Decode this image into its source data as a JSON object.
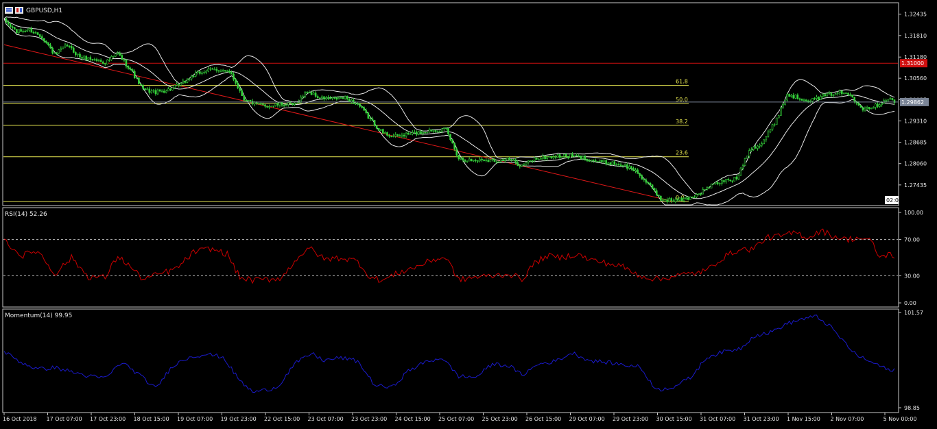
{
  "chart_data": [
    {
      "type": "candlestick",
      "title": "GBPUSD,H1",
      "symbol": "GBPUSD",
      "timeframe": "H1",
      "ylim": [
        1.2685,
        1.3275
      ],
      "y_ticks": [
        "1.32435",
        "1.31810",
        "1.31180",
        "1.30560",
        "1.29935",
        "1.29310",
        "1.28685",
        "1.28060",
        "1.27435"
      ],
      "x_ticks": [
        "16 Oct 2018",
        "17 Oct 07:00",
        "17 Oct 23:00",
        "18 Oct 15:00",
        "19 Oct 07:00",
        "19 Oct 23:00",
        "22 Oct 15:00",
        "23 Oct 07:00",
        "23 Oct 23:00",
        "24 Oct 15:00",
        "25 Oct 07:00",
        "25 Oct 23:00",
        "26 Oct 15:00",
        "29 Oct 07:00",
        "29 Oct 23:00",
        "30 Oct 15:00",
        "31 Oct 07:00",
        "31 Oct 23:00",
        "1 Nov 15:00",
        "2 Nov 07:00",
        "5 Nov 00:00"
      ],
      "current_price": "1.29862",
      "current_price_value": 1.29862,
      "resistance_level": "1.31000",
      "resistance_value": 1.31,
      "fibonacci_levels": [
        {
          "label": "61.8",
          "price": 1.3035
        },
        {
          "label": "50.0",
          "price": 1.2982
        },
        {
          "label": "38.2",
          "price": 1.2918
        },
        {
          "label": "23.6",
          "price": 1.2826
        },
        {
          "label": "0.0",
          "price": 1.2695
        }
      ],
      "trendline": {
        "from": {
          "x": "16 Oct 2018",
          "price": 1.3154
        },
        "to": {
          "x": "30 Oct 15:00",
          "price": 1.2695
        }
      },
      "countdown": "02:0",
      "close_path": [
        {
          "i": 0,
          "price": 1.3225
        },
        {
          "i": 6,
          "price": 1.3192
        },
        {
          "i": 12,
          "price": 1.3198
        },
        {
          "i": 18,
          "price": 1.3178
        },
        {
          "i": 24,
          "price": 1.3125
        },
        {
          "i": 30,
          "price": 1.3152
        },
        {
          "i": 36,
          "price": 1.3118
        },
        {
          "i": 42,
          "price": 1.3112
        },
        {
          "i": 48,
          "price": 1.3102
        },
        {
          "i": 54,
          "price": 1.3128
        },
        {
          "i": 60,
          "price": 1.3082
        },
        {
          "i": 66,
          "price": 1.3022
        },
        {
          "i": 72,
          "price": 1.3015
        },
        {
          "i": 78,
          "price": 1.3022
        },
        {
          "i": 84,
          "price": 1.3038
        },
        {
          "i": 90,
          "price": 1.3065
        },
        {
          "i": 96,
          "price": 1.3078
        },
        {
          "i": 102,
          "price": 1.3082
        },
        {
          "i": 108,
          "price": 1.3068
        },
        {
          "i": 114,
          "price": 1.2995
        },
        {
          "i": 120,
          "price": 1.2978
        },
        {
          "i": 126,
          "price": 1.2975
        },
        {
          "i": 132,
          "price": 1.298
        },
        {
          "i": 138,
          "price": 1.2978
        },
        {
          "i": 144,
          "price": 1.3018
        },
        {
          "i": 150,
          "price": 1.2998
        },
        {
          "i": 156,
          "price": 1.2995
        },
        {
          "i": 162,
          "price": 1.2998
        },
        {
          "i": 168,
          "price": 1.298
        },
        {
          "i": 174,
          "price": 1.2935
        },
        {
          "i": 180,
          "price": 1.2895
        },
        {
          "i": 186,
          "price": 1.2885
        },
        {
          "i": 192,
          "price": 1.2892
        },
        {
          "i": 198,
          "price": 1.2898
        },
        {
          "i": 204,
          "price": 1.2905
        },
        {
          "i": 210,
          "price": 1.2905
        },
        {
          "i": 216,
          "price": 1.2822
        },
        {
          "i": 222,
          "price": 1.2815
        },
        {
          "i": 228,
          "price": 1.2818
        },
        {
          "i": 234,
          "price": 1.2815
        },
        {
          "i": 240,
          "price": 1.2818
        },
        {
          "i": 246,
          "price": 1.28
        },
        {
          "i": 252,
          "price": 1.282
        },
        {
          "i": 258,
          "price": 1.2825
        },
        {
          "i": 264,
          "price": 1.2828
        },
        {
          "i": 270,
          "price": 1.2828
        },
        {
          "i": 276,
          "price": 1.2822
        },
        {
          "i": 282,
          "price": 1.2812
        },
        {
          "i": 288,
          "price": 1.2808
        },
        {
          "i": 294,
          "price": 1.2802
        },
        {
          "i": 300,
          "price": 1.2785
        },
        {
          "i": 306,
          "price": 1.2745
        },
        {
          "i": 312,
          "price": 1.2702
        },
        {
          "i": 318,
          "price": 1.2698
        },
        {
          "i": 324,
          "price": 1.2702
        },
        {
          "i": 330,
          "price": 1.2718
        },
        {
          "i": 336,
          "price": 1.2742
        },
        {
          "i": 342,
          "price": 1.2755
        },
        {
          "i": 348,
          "price": 1.2762
        },
        {
          "i": 354,
          "price": 1.2848
        },
        {
          "i": 360,
          "price": 1.2865
        },
        {
          "i": 366,
          "price": 1.2925
        },
        {
          "i": 372,
          "price": 1.3008
        },
        {
          "i": 378,
          "price": 1.2998
        },
        {
          "i": 384,
          "price": 1.2992
        },
        {
          "i": 390,
          "price": 1.3005
        },
        {
          "i": 396,
          "price": 1.3015
        },
        {
          "i": 402,
          "price": 1.3008
        },
        {
          "i": 408,
          "price": 1.2968
        },
        {
          "i": 414,
          "price": 1.2975
        },
        {
          "i": 420,
          "price": 1.2998
        },
        {
          "i": 423,
          "price": 1.2986
        }
      ],
      "series": [
        {
          "name": "Bollinger Bands",
          "color": "#e8e8e8"
        }
      ]
    },
    {
      "type": "line",
      "indicator": "RSI",
      "title": "RSI(14) 52.26",
      "ylim": [
        0,
        100
      ],
      "y_ticks": [
        "100.00",
        "70.00",
        "30.00",
        "0.00"
      ],
      "levels": [
        70,
        30
      ],
      "series": [
        {
          "color": "#cc0000",
          "points": [
            {
              "i": 0,
              "v": 70
            },
            {
              "i": 8,
              "v": 52
            },
            {
              "i": 16,
              "v": 58
            },
            {
              "i": 24,
              "v": 32
            },
            {
              "i": 32,
              "v": 50
            },
            {
              "i": 40,
              "v": 29
            },
            {
              "i": 48,
              "v": 28
            },
            {
              "i": 54,
              "v": 52
            },
            {
              "i": 60,
              "v": 40
            },
            {
              "i": 66,
              "v": 26
            },
            {
              "i": 74,
              "v": 32
            },
            {
              "i": 82,
              "v": 38
            },
            {
              "i": 90,
              "v": 56
            },
            {
              "i": 98,
              "v": 60
            },
            {
              "i": 106,
              "v": 54
            },
            {
              "i": 112,
              "v": 28
            },
            {
              "i": 118,
              "v": 25
            },
            {
              "i": 126,
              "v": 26
            },
            {
              "i": 132,
              "v": 28
            },
            {
              "i": 140,
              "v": 52
            },
            {
              "i": 146,
              "v": 60
            },
            {
              "i": 152,
              "v": 48
            },
            {
              "i": 160,
              "v": 50
            },
            {
              "i": 168,
              "v": 46
            },
            {
              "i": 174,
              "v": 28
            },
            {
              "i": 180,
              "v": 25
            },
            {
              "i": 188,
              "v": 34
            },
            {
              "i": 196,
              "v": 40
            },
            {
              "i": 204,
              "v": 48
            },
            {
              "i": 210,
              "v": 50
            },
            {
              "i": 216,
              "v": 25
            },
            {
              "i": 222,
              "v": 28
            },
            {
              "i": 232,
              "v": 30
            },
            {
              "i": 240,
              "v": 32
            },
            {
              "i": 246,
              "v": 26
            },
            {
              "i": 252,
              "v": 44
            },
            {
              "i": 258,
              "v": 52
            },
            {
              "i": 264,
              "v": 50
            },
            {
              "i": 272,
              "v": 54
            },
            {
              "i": 278,
              "v": 48
            },
            {
              "i": 286,
              "v": 44
            },
            {
              "i": 294,
              "v": 40
            },
            {
              "i": 300,
              "v": 32
            },
            {
              "i": 306,
              "v": 28
            },
            {
              "i": 312,
              "v": 26
            },
            {
              "i": 318,
              "v": 30
            },
            {
              "i": 326,
              "v": 32
            },
            {
              "i": 334,
              "v": 36
            },
            {
              "i": 340,
              "v": 48
            },
            {
              "i": 348,
              "v": 58
            },
            {
              "i": 356,
              "v": 60
            },
            {
              "i": 362,
              "v": 72
            },
            {
              "i": 370,
              "v": 74
            },
            {
              "i": 376,
              "v": 78
            },
            {
              "i": 382,
              "v": 72
            },
            {
              "i": 388,
              "v": 80
            },
            {
              "i": 394,
              "v": 74
            },
            {
              "i": 400,
              "v": 70
            },
            {
              "i": 406,
              "v": 72
            },
            {
              "i": 412,
              "v": 68
            },
            {
              "i": 416,
              "v": 50
            },
            {
              "i": 420,
              "v": 54
            },
            {
              "i": 423,
              "v": 52
            }
          ]
        }
      ]
    },
    {
      "type": "line",
      "indicator": "Momentum",
      "title": "Momentum(14) 99.95",
      "ylim": [
        98.85,
        101.57
      ],
      "y_ticks": [
        "101.57",
        "98.85"
      ],
      "series": [
        {
          "color": "#1a1acc",
          "points": [
            {
              "i": 0,
              "v": 100.45
            },
            {
              "i": 8,
              "v": 100.15
            },
            {
              "i": 16,
              "v": 99.95
            },
            {
              "i": 24,
              "v": 100.0
            },
            {
              "i": 32,
              "v": 99.88
            },
            {
              "i": 40,
              "v": 99.75
            },
            {
              "i": 48,
              "v": 99.7
            },
            {
              "i": 56,
              "v": 100.15
            },
            {
              "i": 64,
              "v": 99.8
            },
            {
              "i": 72,
              "v": 99.4
            },
            {
              "i": 80,
              "v": 100.05
            },
            {
              "i": 88,
              "v": 100.3
            },
            {
              "i": 96,
              "v": 100.38
            },
            {
              "i": 104,
              "v": 100.3
            },
            {
              "i": 112,
              "v": 99.62
            },
            {
              "i": 118,
              "v": 99.3
            },
            {
              "i": 124,
              "v": 99.35
            },
            {
              "i": 130,
              "v": 99.45
            },
            {
              "i": 138,
              "v": 100.1
            },
            {
              "i": 146,
              "v": 100.4
            },
            {
              "i": 152,
              "v": 100.2
            },
            {
              "i": 160,
              "v": 100.28
            },
            {
              "i": 168,
              "v": 100.18
            },
            {
              "i": 176,
              "v": 99.5
            },
            {
              "i": 184,
              "v": 99.42
            },
            {
              "i": 192,
              "v": 99.9
            },
            {
              "i": 200,
              "v": 100.15
            },
            {
              "i": 208,
              "v": 100.28
            },
            {
              "i": 216,
              "v": 99.75
            },
            {
              "i": 224,
              "v": 99.72
            },
            {
              "i": 232,
              "v": 100.1
            },
            {
              "i": 240,
              "v": 100.05
            },
            {
              "i": 246,
              "v": 99.78
            },
            {
              "i": 254,
              "v": 100.1
            },
            {
              "i": 262,
              "v": 100.18
            },
            {
              "i": 270,
              "v": 100.42
            },
            {
              "i": 278,
              "v": 100.2
            },
            {
              "i": 286,
              "v": 100.15
            },
            {
              "i": 294,
              "v": 100.08
            },
            {
              "i": 302,
              "v": 100.02
            },
            {
              "i": 310,
              "v": 99.35
            },
            {
              "i": 318,
              "v": 99.45
            },
            {
              "i": 326,
              "v": 99.7
            },
            {
              "i": 334,
              "v": 100.3
            },
            {
              "i": 342,
              "v": 100.45
            },
            {
              "i": 350,
              "v": 100.55
            },
            {
              "i": 356,
              "v": 100.9
            },
            {
              "i": 364,
              "v": 101.0
            },
            {
              "i": 372,
              "v": 101.25
            },
            {
              "i": 380,
              "v": 101.4
            },
            {
              "i": 386,
              "v": 101.45
            },
            {
              "i": 392,
              "v": 101.2
            },
            {
              "i": 398,
              "v": 100.8
            },
            {
              "i": 404,
              "v": 100.4
            },
            {
              "i": 410,
              "v": 100.2
            },
            {
              "i": 416,
              "v": 100.05
            },
            {
              "i": 420,
              "v": 99.92
            },
            {
              "i": 423,
              "v": 99.95
            }
          ]
        }
      ]
    }
  ],
  "ui": {
    "colors": {
      "background": "#000000",
      "grid_frame": "#c8c8c8",
      "text": "#e6e6e6",
      "bull_candle": "#34d03a",
      "bear_candle": "#1e7f22",
      "bands": "#e8e8e8",
      "resistance": "#d01010",
      "fib": "#e6e650",
      "trendline": "#e01818",
      "current_price_tag": "#7a8496",
      "rsi_line": "#cc0000",
      "momentum_line": "#1a1acc"
    }
  }
}
